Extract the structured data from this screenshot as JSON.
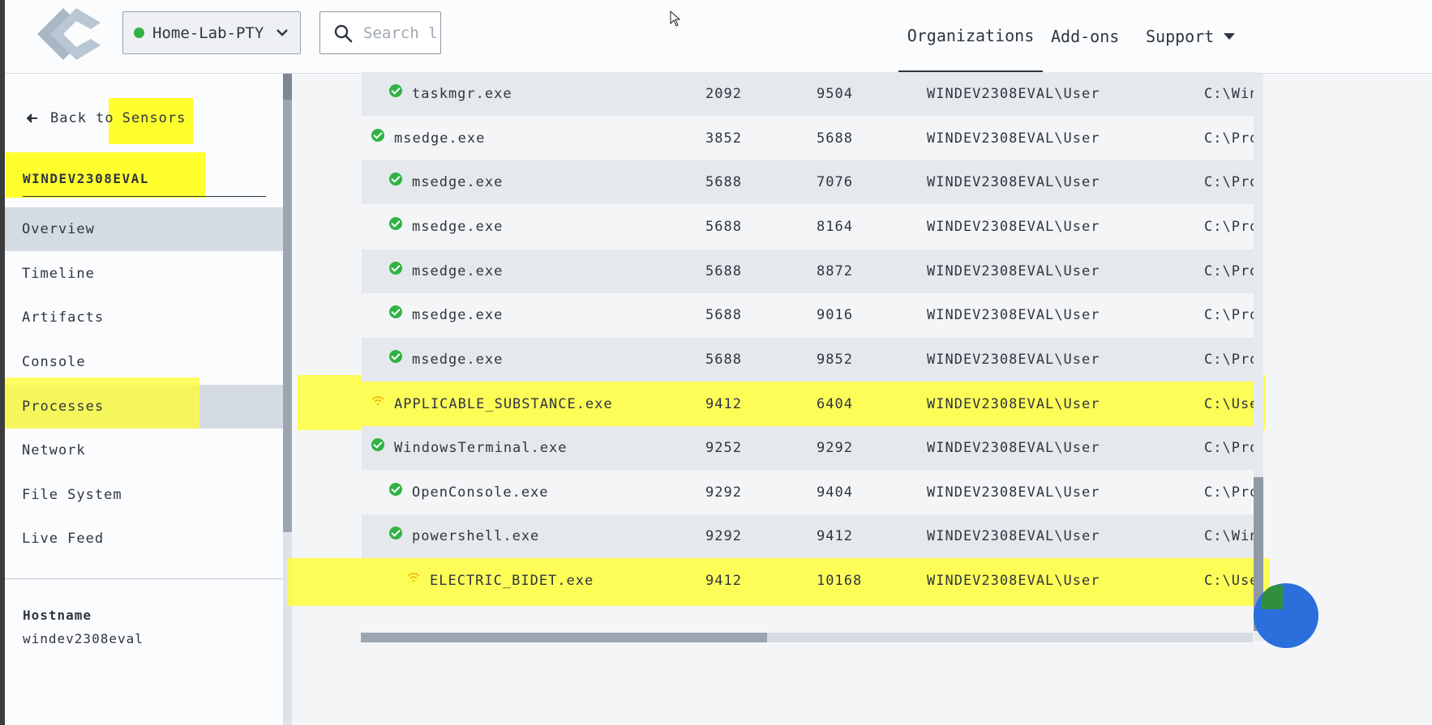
{
  "header": {
    "org_name": "Home-Lab-PTY",
    "org_status_color": "#2fb344",
    "search_placeholder": "Search l",
    "nav": [
      {
        "label": "Organizations"
      },
      {
        "label": "Add-ons"
      },
      {
        "label": "Support"
      }
    ]
  },
  "sidebar": {
    "back_prefix": "Back to",
    "back_target": "Sensors",
    "sensor_name": "WINDEV2308EVAL",
    "menu": [
      {
        "label": "Overview"
      },
      {
        "label": "Timeline"
      },
      {
        "label": "Artifacts"
      },
      {
        "label": "Console"
      },
      {
        "label": "Processes"
      },
      {
        "label": "Network"
      },
      {
        "label": "File System"
      },
      {
        "label": "Live Feed"
      }
    ],
    "hostname_label": "Hostname",
    "hostname_value": "windev2308eval"
  },
  "processes": {
    "rows": [
      {
        "name": "taskmgr.exe",
        "pid": "2092",
        "tid": "9504",
        "user": "WINDEV2308EVAL\\User",
        "path": "C:\\Win",
        "status": "ok"
      },
      {
        "name": "msedge.exe",
        "pid": "3852",
        "tid": "5688",
        "user": "WINDEV2308EVAL\\User",
        "path": "C:\\Pro",
        "status": "ok"
      },
      {
        "name": "msedge.exe",
        "pid": "5688",
        "tid": "7076",
        "user": "WINDEV2308EVAL\\User",
        "path": "C:\\Pro",
        "status": "ok"
      },
      {
        "name": "msedge.exe",
        "pid": "5688",
        "tid": "8164",
        "user": "WINDEV2308EVAL\\User",
        "path": "C:\\Pro",
        "status": "ok"
      },
      {
        "name": "msedge.exe",
        "pid": "5688",
        "tid": "8872",
        "user": "WINDEV2308EVAL\\User",
        "path": "C:\\Pro",
        "status": "ok"
      },
      {
        "name": "msedge.exe",
        "pid": "5688",
        "tid": "9016",
        "user": "WINDEV2308EVAL\\User",
        "path": "C:\\Pro",
        "status": "ok"
      },
      {
        "name": "msedge.exe",
        "pid": "5688",
        "tid": "9852",
        "user": "WINDEV2308EVAL\\User",
        "path": "C:\\Pro",
        "status": "ok"
      },
      {
        "name": "APPLICABLE_SUBSTANCE.exe",
        "pid": "9412",
        "tid": "6404",
        "user": "WINDEV2308EVAL\\User",
        "path": "C:\\Use",
        "status": "network"
      },
      {
        "name": "WindowsTerminal.exe",
        "pid": "9252",
        "tid": "9292",
        "user": "WINDEV2308EVAL\\User",
        "path": "C:\\Pro",
        "status": "ok"
      },
      {
        "name": "OpenConsole.exe",
        "pid": "9292",
        "tid": "9404",
        "user": "WINDEV2308EVAL\\User",
        "path": "C:\\Pro",
        "status": "ok"
      },
      {
        "name": "powershell.exe",
        "pid": "9292",
        "tid": "9412",
        "user": "WINDEV2308EVAL\\User",
        "path": "C:\\Win",
        "status": "ok"
      },
      {
        "name": "ELECTRIC_BIDET.exe",
        "pid": "9412",
        "tid": "10168",
        "user": "WINDEV2308EVAL\\User",
        "path": "C:\\Use",
        "status": "network"
      }
    ]
  },
  "colors": {
    "highlight": "#ffff2e",
    "ok_status": "#2fb344",
    "network_status": "#f2b705"
  }
}
